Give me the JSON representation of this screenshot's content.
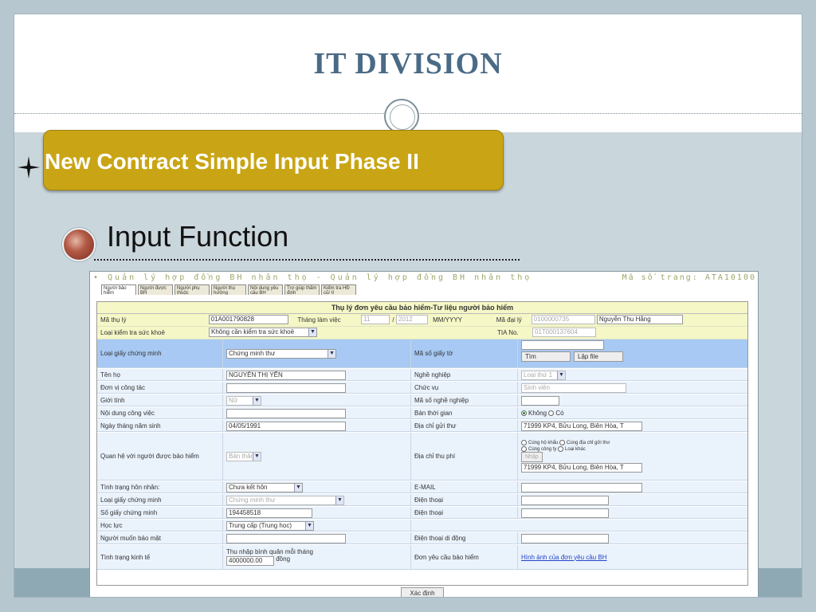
{
  "slide": {
    "title": "IT DIVISION",
    "subtitle": "New Contract Simple Input Phase II",
    "heading": "Input Function"
  },
  "app": {
    "header_title": "• Quản lý hợp đồng BH nhân thọ - Quản lý hợp đồng BH nhân thọ",
    "page_code": "Mã số trang: ATA10100",
    "tabs": [
      "Người bảo hiểm",
      "Người được BH",
      "Người phụ thuộc",
      "Người thụ hưởng",
      "Nội dung yêu cầu BH",
      "Trợ giúp thẩm định",
      "Kiểm tra HĐ cũ/ II"
    ],
    "form_title": "Thụ lý đơn yêu cầu bảo hiểm-Tư liệu người bảo hiểm",
    "ma_thu_ly": {
      "label": "Mã thụ lý",
      "value": "01A001790828"
    },
    "thang_lam_viec": {
      "label": "Tháng làm việc",
      "month": "11",
      "sep": "/",
      "year": "2012",
      "format": "MM/YYYY"
    },
    "ma_dai_ly": {
      "label": "Mã đại lý",
      "code": "0100000735",
      "name": "Nguyễn Thu Hằng"
    },
    "loai_kiem_tra": {
      "label": "Loại kiểm tra sức khoẻ",
      "value": "Không cần kiểm tra sức khoẻ"
    },
    "tia_no": {
      "label": "TIA No.",
      "value": "01T000137604"
    },
    "left_fields": [
      {
        "label": "Loại giấy chứng minh",
        "value": "Chứng minh thư",
        "kind": "select"
      },
      {
        "label": "Tên họ",
        "value": "NGUYỄN THỊ YẾN",
        "kind": "input"
      },
      {
        "label": "Đơn vị công tác",
        "value": "",
        "kind": "input"
      },
      {
        "label": "Giới tính",
        "value": "Nữ",
        "kind": "select-dis"
      },
      {
        "label": "Nội dung công việc",
        "value": "",
        "kind": "input"
      },
      {
        "label": "Ngày tháng năm sinh",
        "value": "04/05/1991",
        "kind": "input"
      },
      {
        "label": "Quan hệ với người được bảo hiểm",
        "value": "Bản thân",
        "kind": "select-dis"
      },
      {
        "label": "Tình trạng hôn nhân:",
        "value": "Chưa kết hôn",
        "kind": "select"
      },
      {
        "label": "Loại giấy chứng minh",
        "value": "Chứng minh thư",
        "kind": "select-dis"
      },
      {
        "label": "Số giấy chứng minh",
        "value": "194458518",
        "kind": "input"
      },
      {
        "label": "Học lực",
        "value": "Trung cấp (Trung học)",
        "kind": "select"
      },
      {
        "label": "Người muốn bảo mật",
        "value": "",
        "kind": "input"
      },
      {
        "label": "Tình trạng kinh tế",
        "value": "Thu nhập bình quân mỗi tháng",
        "amount": "4000000.00",
        "unit": "đồng",
        "kind": "income"
      }
    ],
    "right_fields": [
      {
        "label": "Mã số giấy tờ",
        "value": "",
        "btn_find": "Tìm",
        "btn_file": "Lập file"
      },
      {
        "label": "Nghề nghiệp",
        "value": "Loại thứ 1"
      },
      {
        "label": "Chức vụ",
        "value": "Sinh viên"
      },
      {
        "label": "Mã số nghề nghiệp",
        "value": ""
      },
      {
        "label": "Bán thời gian",
        "opt_no": "Không",
        "opt_yes": "Có"
      },
      {
        "label": "Địa chỉ gửi thư",
        "value": "71999 KP4, Bửu Long, Biên Hòa,  T"
      },
      {
        "label": "Địa chỉ thu phí",
        "opt1": "Cùng hộ khẩu",
        "opt2": "Cùng địa chỉ gửi thư",
        "opt3": "Cùng công ty",
        "opt4": "Loại khác",
        "btn": "Nhập",
        "value": "71999 KP4, Bửu Long, Biên Hòa,  T"
      },
      {
        "label": "E-MAIL",
        "value": ""
      },
      {
        "label": "Điện thoại",
        "value": ""
      },
      {
        "label": "Điện thoại",
        "value": ""
      },
      {
        "label": "Điện thoại di động",
        "value": ""
      },
      {
        "label": "Đơn yêu cầu bảo hiểm",
        "link": "Hình ảnh của đơn yêu cầu BH"
      }
    ],
    "submit": "Xác định"
  }
}
